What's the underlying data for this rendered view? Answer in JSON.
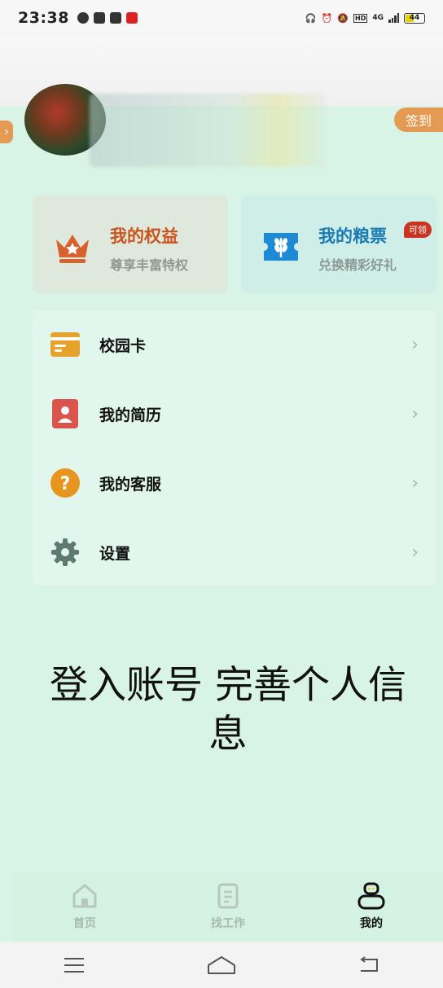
{
  "status_bar": {
    "time": "23:38",
    "network": "4G",
    "battery": "44",
    "hd": "HD"
  },
  "profile": {
    "signin_label": "签到"
  },
  "cards": [
    {
      "title": "我的权益",
      "subtitle": "尊享丰富特权",
      "icon": "crown-icon"
    },
    {
      "title": "我的粮票",
      "subtitle": "兑换精彩好礼",
      "icon": "grain-ticket-icon",
      "badge": "可领"
    }
  ],
  "menu": [
    {
      "label": "校园卡",
      "icon": "card-icon"
    },
    {
      "label": "我的简历",
      "icon": "resume-icon"
    },
    {
      "label": "我的客服",
      "icon": "question-icon"
    },
    {
      "label": "设置",
      "icon": "gear-icon"
    }
  ],
  "overlay": {
    "text": "登入账号 完善个人信息"
  },
  "tabs": [
    {
      "label": "首页",
      "icon": "home-icon",
      "active": false
    },
    {
      "label": "找工作",
      "icon": "document-icon",
      "active": false
    },
    {
      "label": "我的",
      "icon": "profile-icon",
      "active": true
    }
  ],
  "colors": {
    "accent_orange": "#e59a53",
    "rights_red": "#c9541d",
    "tickets_blue": "#1a7bb5",
    "background": "#d8f4e6"
  }
}
